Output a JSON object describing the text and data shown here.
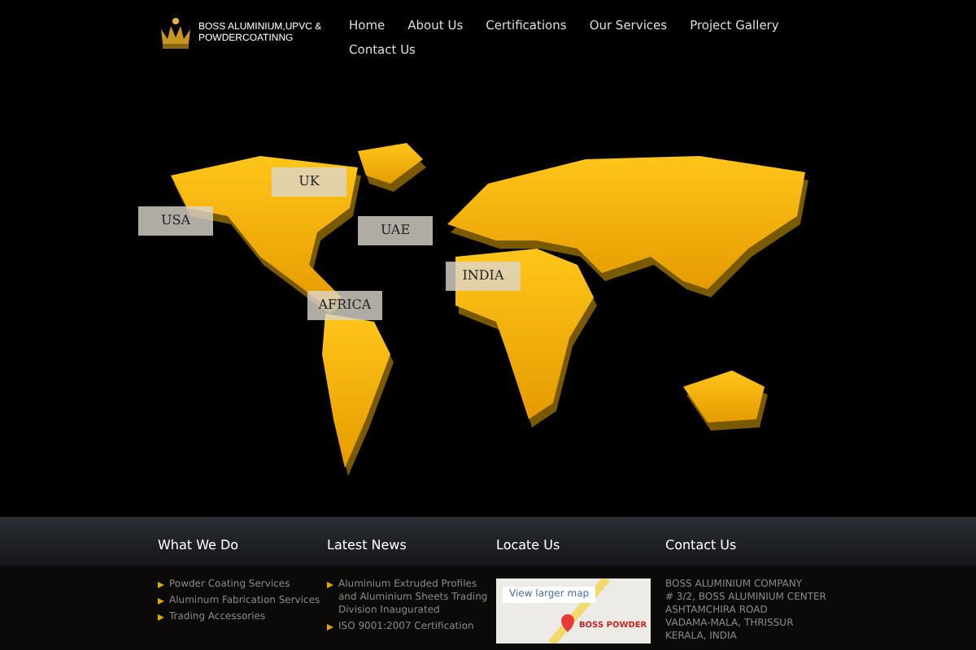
{
  "brand": {
    "name": "BOSS ALUMINIUM,UPVC & POWDERCOATINNG"
  },
  "nav": [
    "Home",
    "About Us",
    "Certifications",
    "Our Services",
    "Project Gallery",
    "Contact Us"
  ],
  "map_labels": [
    "USA",
    "UK",
    "UAE",
    "INDIA",
    "AFRICA"
  ],
  "footer": {
    "what_we_do": {
      "title": "What We Do",
      "items": [
        "Powder Coating Services",
        "Aluminum Fabrication Services",
        "Trading Accessories"
      ]
    },
    "latest_news": {
      "title": "Latest News",
      "items": [
        "Aluminium Extruded Profiles and Aluminium Sheets Trading Division Inaugurated",
        "ISO 9001:2007 Certification"
      ]
    },
    "locate_us": {
      "title": "Locate Us",
      "link": "View larger map",
      "place": "BOSS POWDER"
    },
    "contact_us": {
      "title": "Contact Us",
      "lines": [
        "BOSS ALUMINIUM COMPANY",
        "# 3/2, BOSS ALUMINIUM CENTER",
        "ASHTAMCHIRA ROAD",
        "VADAMA-MALA, THRISSUR",
        "KERALA, INDIA"
      ]
    }
  }
}
